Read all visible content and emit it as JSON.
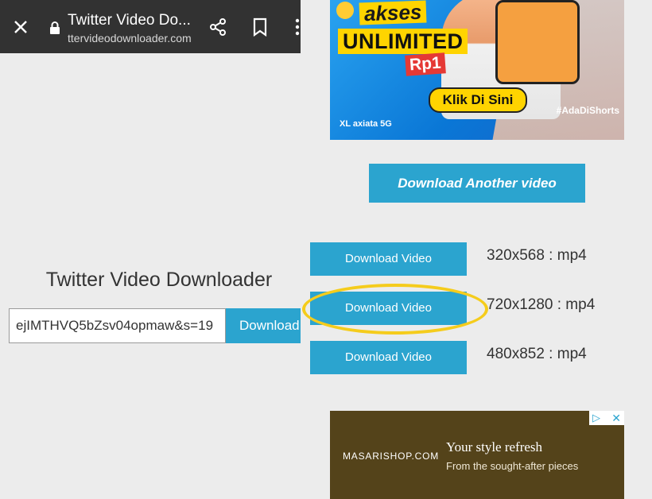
{
  "left": {
    "topbar": {
      "title": "Twitter Video Do...",
      "url": "ttervideodownloader.com"
    },
    "heading": "Twitter Video Downloader",
    "url_input_value": "ejIMTHVQ5bZsv04opmaw&s=19",
    "download_label": "Download"
  },
  "right": {
    "ad_top": {
      "akses": "akses",
      "unlimited": "UNLIMITED",
      "price": "Rp1",
      "cta": "Klik Di Sini",
      "hashtag": "#AdaDiShorts",
      "brand": "XL axiata 5G"
    },
    "another_label": "Download Another video",
    "downloads": [
      {
        "label": "Download Video",
        "resolution": "320x568 : mp4"
      },
      {
        "label": "Download Video",
        "resolution": "720x1280 : mp4"
      },
      {
        "label": "Download Video",
        "resolution": "480x852 : mp4"
      }
    ],
    "highlighted_index": 1,
    "highlight_color": "#f5cc1c",
    "ad_bottom": {
      "brand": "MASARISHOP.COM",
      "headline": "Your style refresh",
      "sub": "From the sought-after pieces"
    }
  },
  "colors": {
    "accent": "#2ba4cf",
    "topbar": "#323232",
    "background": "#ececec"
  }
}
